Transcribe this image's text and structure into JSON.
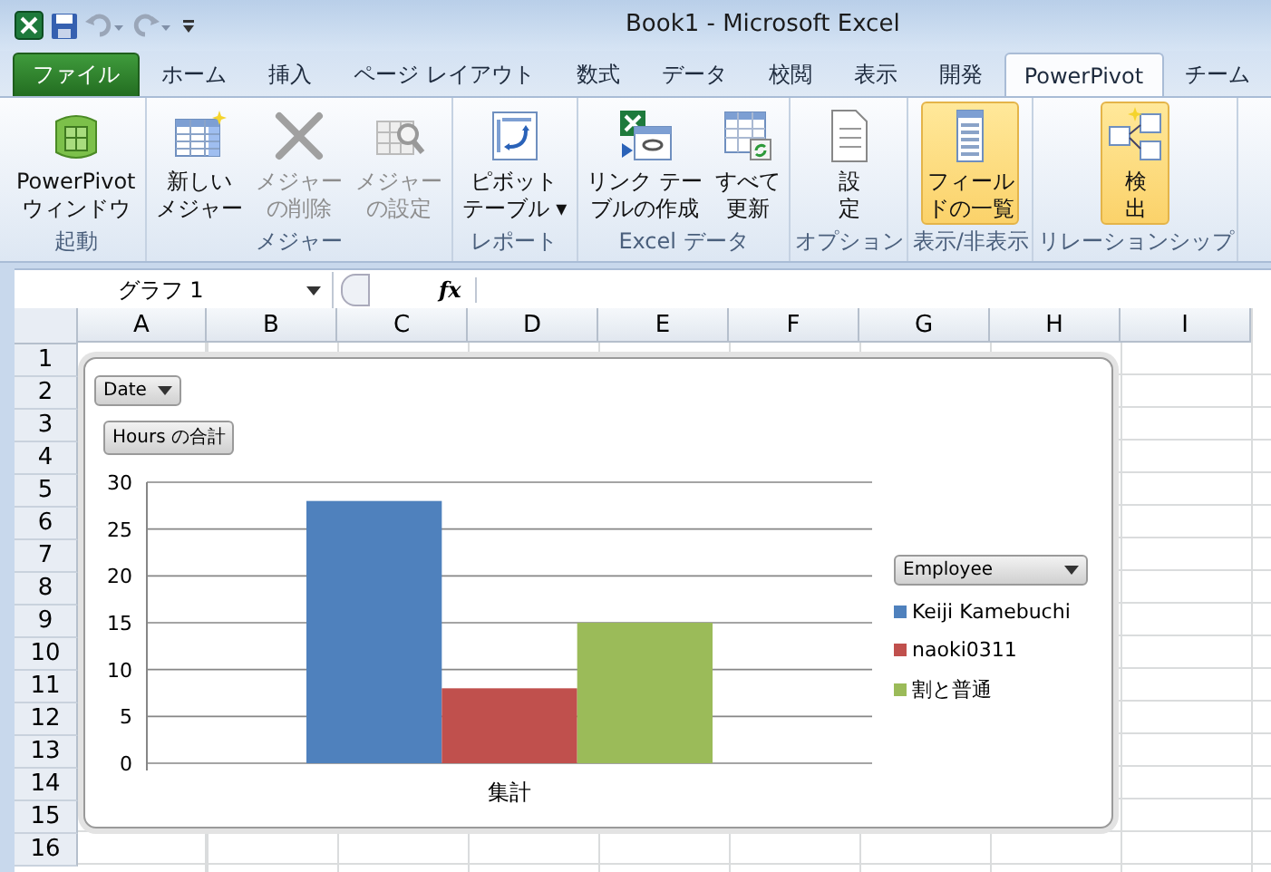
{
  "window": {
    "title": "Book1  -  Microsoft Excel"
  },
  "tabs": [
    {
      "label": "ファイル",
      "kind": "file",
      "selected": false
    },
    {
      "label": "ホーム",
      "kind": "tab",
      "selected": false
    },
    {
      "label": "挿入",
      "kind": "tab",
      "selected": false
    },
    {
      "label": "ページ レイアウト",
      "kind": "tab",
      "selected": false
    },
    {
      "label": "数式",
      "kind": "tab",
      "selected": false
    },
    {
      "label": "データ",
      "kind": "tab",
      "selected": false
    },
    {
      "label": "校閲",
      "kind": "tab",
      "selected": false
    },
    {
      "label": "表示",
      "kind": "tab",
      "selected": false
    },
    {
      "label": "開発",
      "kind": "tab",
      "selected": false
    },
    {
      "label": "PowerPivot",
      "kind": "tab",
      "selected": true
    },
    {
      "label": "チーム",
      "kind": "tab",
      "selected": false
    }
  ],
  "ribbon": [
    {
      "label": "起動",
      "buttons": [
        {
          "lines": [
            "PowerPivot",
            "ウィンドウ"
          ],
          "disabled": false,
          "selected": false
        }
      ]
    },
    {
      "label": "メジャー",
      "buttons": [
        {
          "lines": [
            "新しい",
            "メジャー"
          ],
          "disabled": false,
          "selected": false
        },
        {
          "lines": [
            "メジャー",
            "の削除"
          ],
          "disabled": true,
          "selected": false
        },
        {
          "lines": [
            "メジャー",
            "の設定"
          ],
          "disabled": true,
          "selected": false
        }
      ]
    },
    {
      "label": "レポート",
      "buttons": [
        {
          "lines": [
            "ピボット",
            "テーブル ▾"
          ],
          "disabled": false,
          "selected": false
        }
      ]
    },
    {
      "label": "Excel データ",
      "buttons": [
        {
          "lines": [
            "リンク テー",
            "ブルの作成"
          ],
          "disabled": false,
          "selected": false
        },
        {
          "lines": [
            "すべて",
            "更新"
          ],
          "disabled": false,
          "selected": false
        }
      ]
    },
    {
      "label": "オプション",
      "buttons": [
        {
          "lines": [
            "設",
            "定"
          ],
          "disabled": false,
          "selected": false
        }
      ]
    },
    {
      "label": "表示/非表示",
      "buttons": [
        {
          "lines": [
            "フィール",
            "ドの一覧"
          ],
          "disabled": false,
          "selected": true
        }
      ]
    },
    {
      "label": "リレーションシップ",
      "buttons": [
        {
          "lines": [
            "検",
            "出"
          ],
          "disabled": false,
          "selected": true
        }
      ]
    }
  ],
  "formula_bar": {
    "name_box": "グラフ 1",
    "fx": "fx"
  },
  "columns": [
    "A",
    "B",
    "C",
    "D",
    "E",
    "F",
    "G",
    "H",
    "I"
  ],
  "rows": [
    "1",
    "2",
    "3",
    "4",
    "5",
    "6",
    "7",
    "8",
    "9",
    "10",
    "11",
    "12",
    "13",
    "14",
    "15",
    "16"
  ],
  "chart": {
    "filter": "Date",
    "value_field": "Hours の合計",
    "legend_title": "Employee",
    "chart_data": {
      "type": "bar",
      "grid": true,
      "categories": [
        "集計"
      ],
      "ylim": [
        0,
        30
      ],
      "yticks": [
        0,
        5,
        10,
        15,
        20,
        25,
        30
      ],
      "series": [
        {
          "name": "Keiji Kamebuchi",
          "color": "#4f81bd",
          "values": [
            28
          ]
        },
        {
          "name": "naoki0311",
          "color": "#c0504d",
          "values": [
            8
          ]
        },
        {
          "name": "割と普通",
          "color": "#9bbb59",
          "values": [
            15
          ]
        }
      ]
    }
  }
}
